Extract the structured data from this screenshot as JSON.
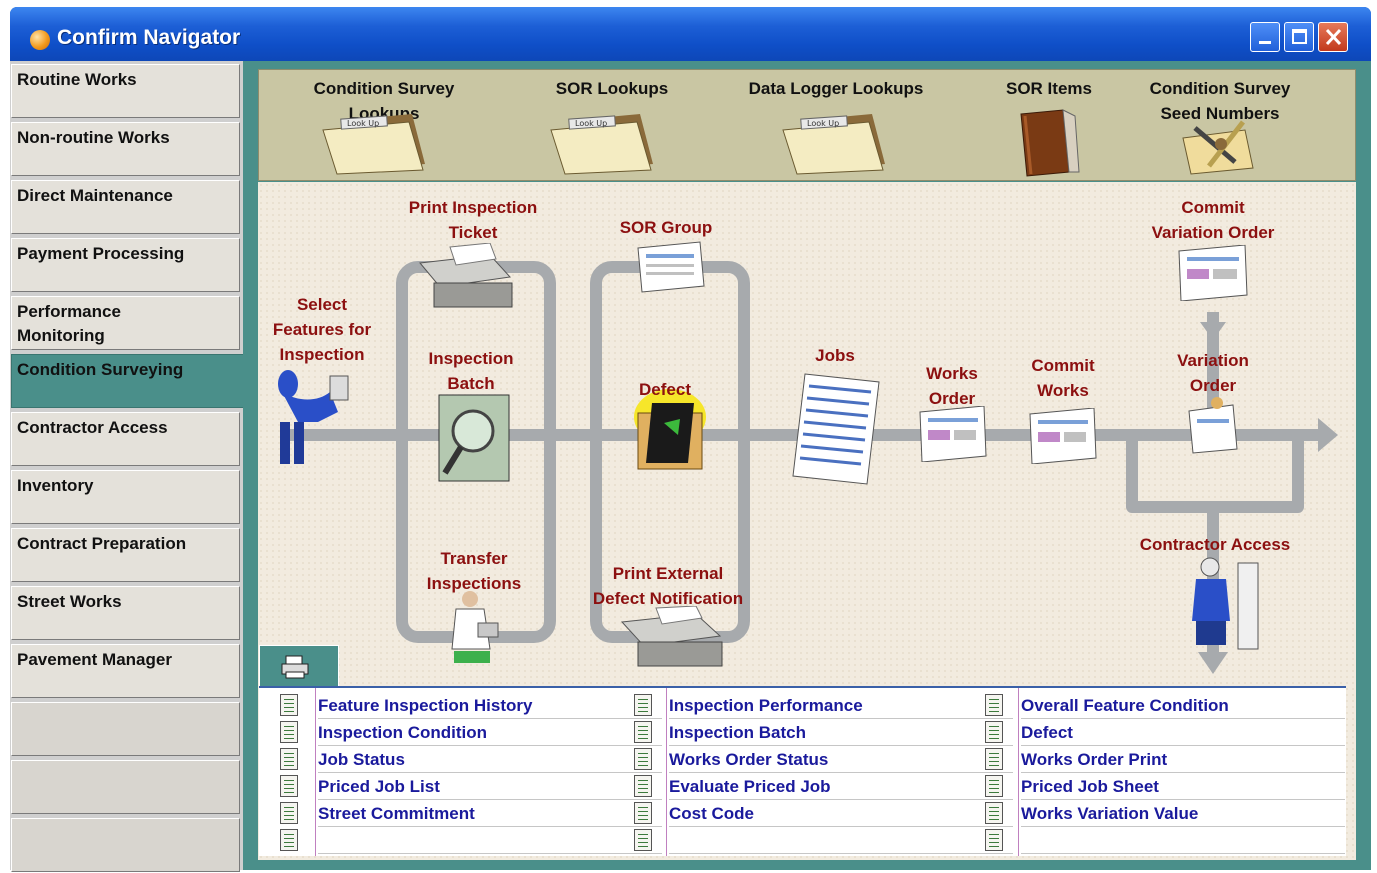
{
  "window": {
    "title": "Confirm Navigator"
  },
  "sidebar": {
    "items": [
      {
        "label": "Routine Works"
      },
      {
        "label": "Non-routine Works"
      },
      {
        "label": "Direct Maintenance"
      },
      {
        "label": "Payment Processing"
      },
      {
        "label": "Performance\nMonitoring"
      },
      {
        "label": "Condition Surveying",
        "active": true
      },
      {
        "label": "Contractor Access"
      },
      {
        "label": "Inventory"
      },
      {
        "label": "Contract Preparation"
      },
      {
        "label": "Street Works"
      },
      {
        "label": "Pavement Manager"
      }
    ]
  },
  "toolbar": {
    "items": [
      {
        "label": "Condition Survey\nLookups",
        "icon": "folder-lookup-icon",
        "folder_tab": "Look Up"
      },
      {
        "label": "SOR Lookups",
        "icon": "folder-lookup-icon",
        "folder_tab": "Look Up"
      },
      {
        "label": "Data Logger Lookups",
        "icon": "folder-lookup-icon",
        "folder_tab": "Look Up"
      },
      {
        "label": "SOR Items",
        "icon": "book-icon"
      },
      {
        "label": "Condition Survey\nSeed Numbers",
        "icon": "tools-icon"
      }
    ]
  },
  "diagram": {
    "nodes": {
      "select_features": "Select\nFeatures for\nInspection",
      "print_ticket": "Print Inspection\nTicket",
      "inspection_batch": "Inspection\nBatch",
      "transfer": "Transfer\nInspections",
      "sor_group": "SOR Group",
      "defect": "Defect",
      "print_external": "Print External\nDefect Notification",
      "jobs": "Jobs",
      "works_order": "Works\nOrder",
      "commit_works": "Commit\nWorks",
      "commit_variation": "Commit\nVariation Order",
      "variation_order": "Variation\nOrder",
      "contractor_access": "Contractor Access"
    }
  },
  "reports": {
    "tab_icon": "printer-icon",
    "columns": [
      [
        "Feature Inspection History",
        "Inspection Condition",
        "Job Status",
        "Priced Job List",
        "Street Commitment",
        ""
      ],
      [
        "Inspection Performance",
        "Inspection Batch",
        "Works Order Status",
        "Evaluate Priced Job",
        "Cost Code",
        ""
      ],
      [
        "Overall Feature Condition",
        "Defect",
        "Works Order Print",
        "Priced Job Sheet",
        "Works Variation Value",
        ""
      ]
    ]
  },
  "colors": {
    "accent": "#4a8f8a",
    "label_red": "#8c1010",
    "link_blue": "#1a1a9c",
    "title_bar": "#1d5fd6"
  }
}
